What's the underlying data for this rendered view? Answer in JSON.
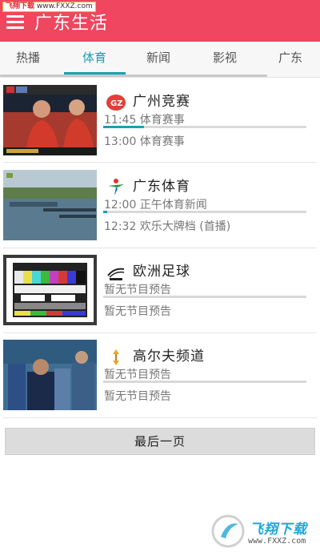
{
  "watermark_top": {
    "brand": "飞翔下载",
    "url": "www.FXXZ.com"
  },
  "appbar": {
    "title": "广东生活"
  },
  "tabs": [
    {
      "label": "热播",
      "active": false
    },
    {
      "label": "体育",
      "active": true
    },
    {
      "label": "新闻",
      "active": false
    },
    {
      "label": "影视",
      "active": false
    },
    {
      "label": "广东",
      "active": false
    }
  ],
  "channels": [
    {
      "name": "广州竞赛",
      "logo_icon": "gz-logo-icon",
      "now": "11:45 体育赛事",
      "progress": 0.2,
      "next": "13:00 体育赛事"
    },
    {
      "name": "广东体育",
      "logo_icon": "guangdong-tv-logo-icon",
      "now": "12:00 正午体育新闻",
      "progress": 0.02,
      "next": "12:32 欢乐大牌档 (首播)"
    },
    {
      "name": "欧洲足球",
      "logo_icon": "euro-football-logo-icon",
      "now": "暂无节目预告",
      "progress": 0,
      "next": "暂无节目预告"
    },
    {
      "name": "高尔夫频道",
      "logo_icon": "golf-logo-icon",
      "now": "暂无节目预告",
      "progress": 0,
      "next": "暂无节目预告"
    }
  ],
  "footer": {
    "last_page_label": "最后一页"
  },
  "watermark_bottom": {
    "brand": "飞翔下载",
    "url": "www.FXXZ.com"
  },
  "colors": {
    "accent": "#f0465f",
    "tab_active": "#1aa1b4",
    "progress": "#1aa1b4"
  }
}
